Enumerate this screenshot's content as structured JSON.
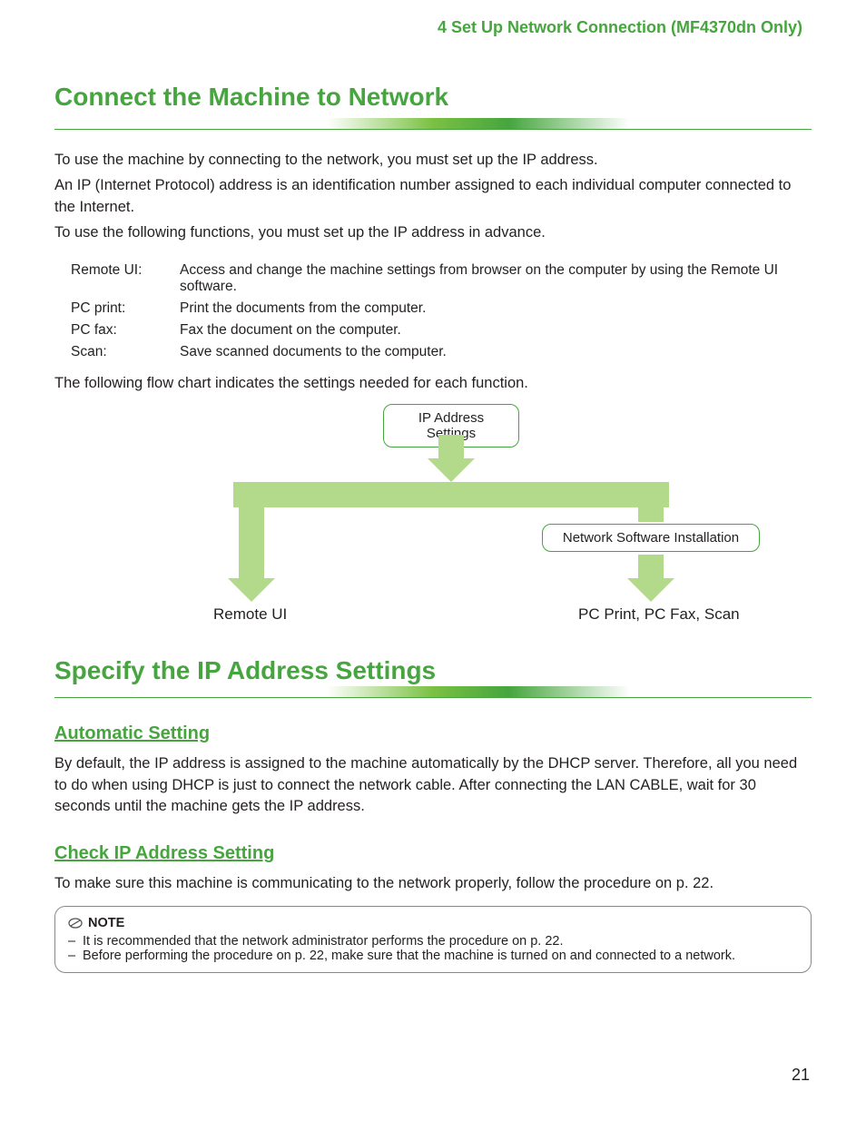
{
  "header": "4 Set Up Network Connection (MF4370dn Only)",
  "section1": {
    "title": "Connect the Machine to Network",
    "paras": [
      "To use the machine by connecting to the network, you must set up the IP address.",
      "An IP (Internet Protocol) address is an identification number assigned to each individual computer connected to the Internet.",
      "To use the following functions, you must set up the IP address in advance."
    ],
    "functions": [
      {
        "label": "Remote UI:",
        "desc": "Access and change the machine settings from browser on the computer by using the Remote UI software."
      },
      {
        "label": "PC print:",
        "desc": "Print the documents from the computer."
      },
      {
        "label": "PC fax:",
        "desc": "Fax the document on the computer."
      },
      {
        "label": "Scan:",
        "desc": "Save scanned documents to the computer."
      }
    ],
    "flow_intro": "The following flow chart indicates the settings needed for each function.",
    "flow": {
      "top": "IP Address Settings",
      "right_box": "Network Software Installation",
      "left_label": "Remote UI",
      "right_label": "PC Print, PC Fax, Scan"
    }
  },
  "section2": {
    "title": "Specify the IP Address Settings",
    "auto": {
      "heading": "Automatic Setting",
      "body": "By default, the IP address is assigned to the machine automatically by the DHCP server. Therefore, all you need to do when using DHCP is just to connect the network cable. After connecting the LAN CABLE, wait for 30 seconds until the machine gets the IP address."
    },
    "check": {
      "heading": "Check IP Address Setting",
      "body": "To make sure this machine is communicating to the network properly, follow the procedure on p. 22."
    },
    "note": {
      "label": "NOTE",
      "items": [
        "It is recommended that the network administrator performs the procedure on p. 22.",
        "Before performing the procedure on p. 22, make sure that the machine is turned on and connected to a network."
      ]
    }
  },
  "page_number": "21"
}
